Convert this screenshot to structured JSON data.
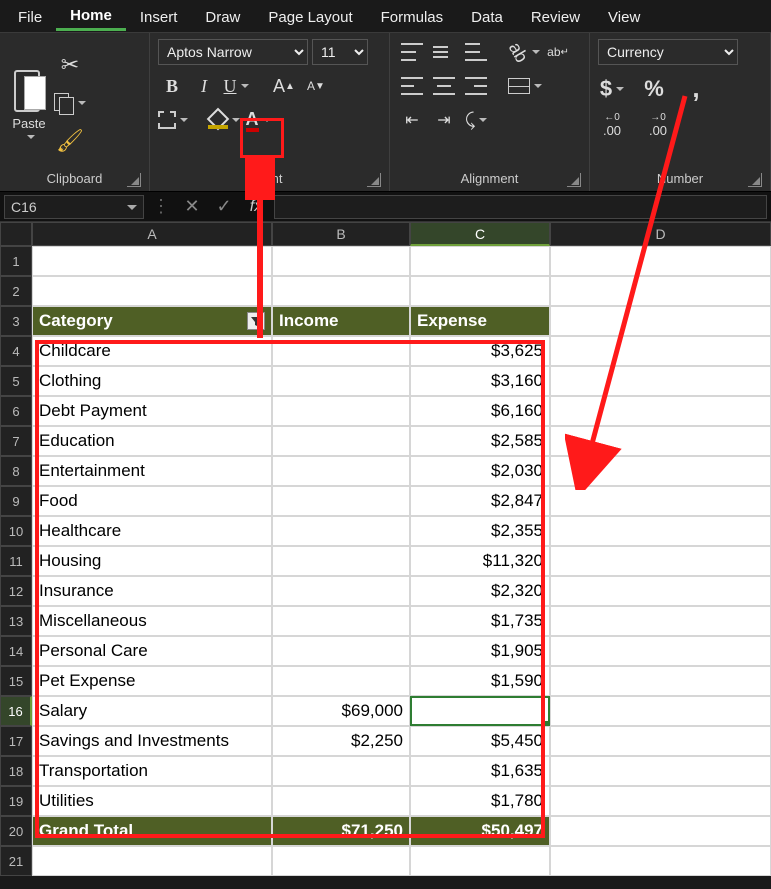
{
  "menu": {
    "tabs": [
      "File",
      "Home",
      "Insert",
      "Draw",
      "Page Layout",
      "Formulas",
      "Data",
      "Review",
      "View"
    ],
    "active": "Home"
  },
  "ribbon": {
    "clipboard": {
      "label": "Clipboard",
      "paste": "Paste"
    },
    "font": {
      "label": "Font",
      "family": "Aptos Narrow",
      "size": "11",
      "bold": "B",
      "italic": "I",
      "underline": "U",
      "growA": "A",
      "shrinkA": "A",
      "fontColorLetter": "A"
    },
    "alignment": {
      "label": "Alignment",
      "wrap": "ab"
    },
    "number": {
      "label": "Number",
      "format": "Currency",
      "dollar": "$",
      "percent": "%",
      "comma": ",",
      "decInc": ".00→.0",
      "decDec": ".0→.00"
    }
  },
  "fbar": {
    "cell": "C16",
    "fx": "fx",
    "value": ""
  },
  "colHeaders": [
    "A",
    "B",
    "C",
    "D"
  ],
  "rowHeaders": [
    "1",
    "2",
    "3",
    "4",
    "5",
    "6",
    "7",
    "8",
    "9",
    "10",
    "11",
    "12",
    "13",
    "14",
    "15",
    "16",
    "17",
    "18",
    "19",
    "20",
    "21"
  ],
  "table": {
    "headers": {
      "cat": "Category",
      "inc": "Income",
      "exp": "Expense"
    },
    "rows": [
      {
        "cat": "Childcare",
        "inc": "",
        "exp": "$3,625"
      },
      {
        "cat": "Clothing",
        "inc": "",
        "exp": "$3,160"
      },
      {
        "cat": "Debt Payment",
        "inc": "",
        "exp": "$6,160"
      },
      {
        "cat": "Education",
        "inc": "",
        "exp": "$2,585"
      },
      {
        "cat": "Entertainment",
        "inc": "",
        "exp": "$2,030"
      },
      {
        "cat": "Food",
        "inc": "",
        "exp": "$2,847"
      },
      {
        "cat": "Healthcare",
        "inc": "",
        "exp": "$2,355"
      },
      {
        "cat": "Housing",
        "inc": "",
        "exp": "$11,320"
      },
      {
        "cat": "Insurance",
        "inc": "",
        "exp": "$2,320"
      },
      {
        "cat": "Miscellaneous",
        "inc": "",
        "exp": "$1,735"
      },
      {
        "cat": "Personal Care",
        "inc": "",
        "exp": "$1,905"
      },
      {
        "cat": "Pet Expense",
        "inc": "",
        "exp": "$1,590"
      },
      {
        "cat": "Salary",
        "inc": "$69,000",
        "exp": ""
      },
      {
        "cat": "Savings and Investments",
        "inc": "$2,250",
        "exp": "$5,450"
      },
      {
        "cat": "Transportation",
        "inc": "",
        "exp": "$1,635"
      },
      {
        "cat": "Utilities",
        "inc": "",
        "exp": "$1,780"
      }
    ],
    "total": {
      "label": "Grand Total",
      "inc": "$71,250",
      "exp": "$50,497"
    }
  },
  "activeCell": "C16"
}
